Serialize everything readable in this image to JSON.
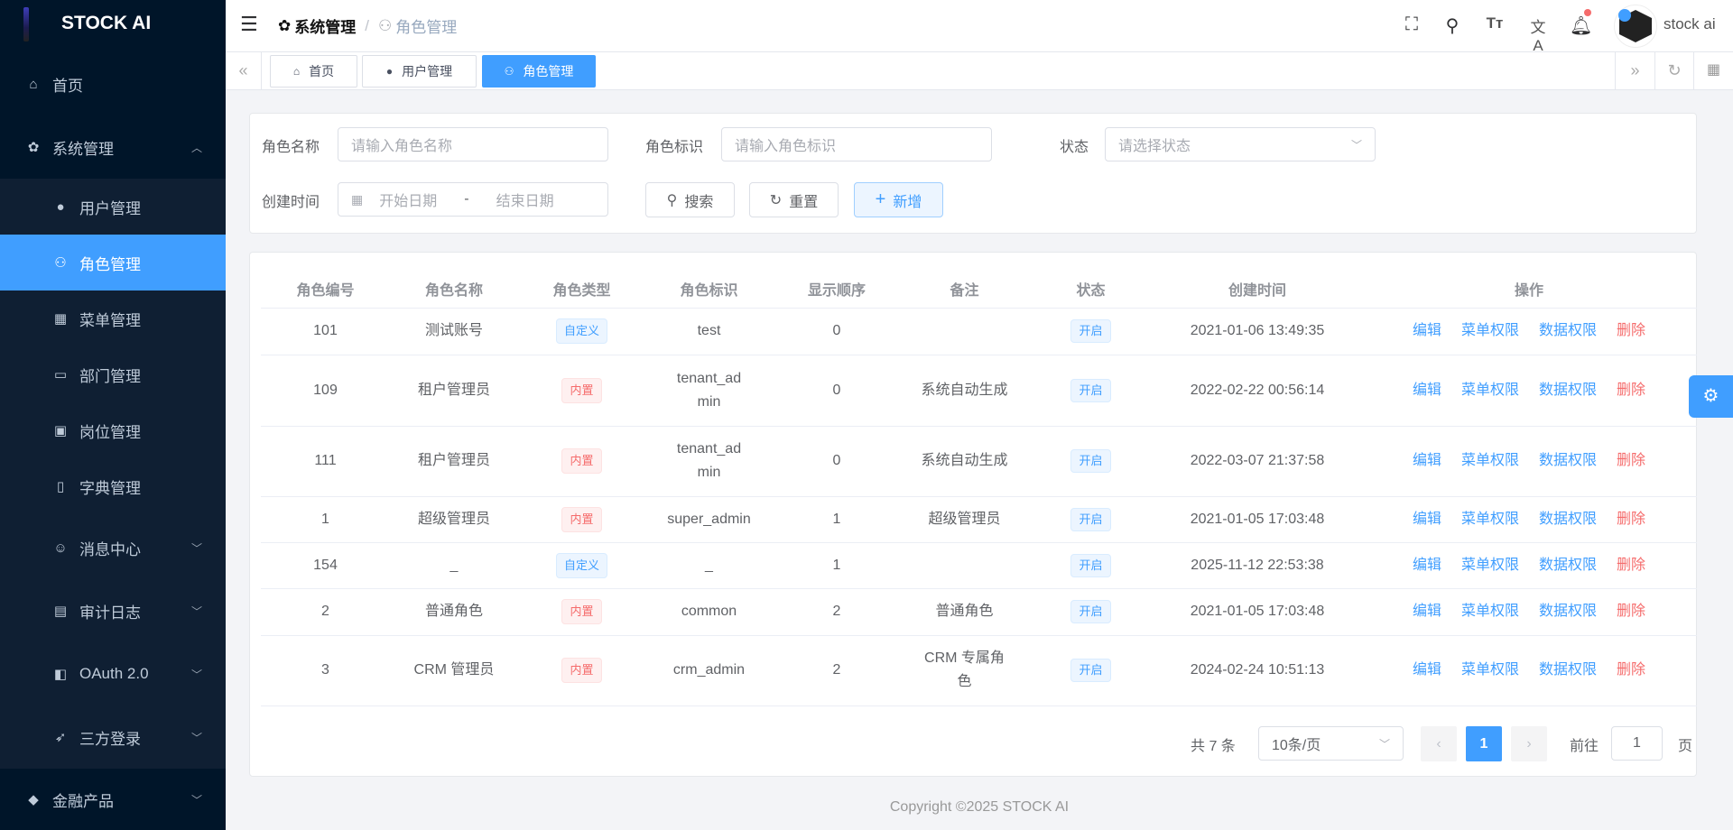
{
  "app": {
    "title": "STOCK AI",
    "user": "stock ai",
    "copyright": "Copyright ©2025 STOCK AI"
  },
  "sidebar": {
    "items": [
      {
        "label": "首页",
        "icon": "home-icon"
      },
      {
        "label": "系统管理",
        "icon": "gear-icon"
      },
      {
        "label": "用户管理",
        "icon": "user-icon"
      },
      {
        "label": "角色管理",
        "icon": "user-outline-icon"
      },
      {
        "label": "菜单管理",
        "icon": "grid-icon"
      },
      {
        "label": "部门管理",
        "icon": "id-card-icon"
      },
      {
        "label": "岗位管理",
        "icon": "badge-icon"
      },
      {
        "label": "字典管理",
        "icon": "book-icon"
      },
      {
        "label": "消息中心",
        "icon": "chat-icon"
      },
      {
        "label": "审计日志",
        "icon": "log-icon"
      },
      {
        "label": "OAuth 2.0",
        "icon": "oauth-icon"
      },
      {
        "label": "三方登录",
        "icon": "rocket-icon"
      },
      {
        "label": "金融产品",
        "icon": "diamond-icon"
      }
    ]
  },
  "breadcrumb": [
    "系统管理",
    "角色管理"
  ],
  "tabs": [
    {
      "label": "首页"
    },
    {
      "label": "用户管理"
    },
    {
      "label": "角色管理"
    }
  ],
  "filter": {
    "name_label": "角色名称",
    "name_placeholder": "请输入角色名称",
    "code_label": "角色标识",
    "code_placeholder": "请输入角色标识",
    "status_label": "状态",
    "status_placeholder": "请选择状态",
    "time_label": "创建时间",
    "start_placeholder": "开始日期",
    "end_placeholder": "结束日期",
    "sep": "-",
    "search": "搜索",
    "reset": "重置",
    "add": "新增"
  },
  "table": {
    "headers": [
      "角色编号",
      "角色名称",
      "角色类型",
      "角色标识",
      "显示顺序",
      "备注",
      "状态",
      "创建时间",
      "操作"
    ],
    "actions": [
      "编辑",
      "菜单权限",
      "数据权限",
      "删除"
    ],
    "rows": [
      {
        "id": "101",
        "name": "测试账号",
        "type": "自定义",
        "code": "test",
        "sort": "0",
        "remark": "",
        "status": "开启",
        "time": "2021-01-06 13:49:35"
      },
      {
        "id": "109",
        "name": "租户管理员",
        "type": "内置",
        "code": "tenant_admin",
        "sort": "0",
        "remark": "系统自动生成",
        "status": "开启",
        "time": "2022-02-22 00:56:14"
      },
      {
        "id": "111",
        "name": "租户管理员",
        "type": "内置",
        "code": "tenant_admin",
        "sort": "0",
        "remark": "系统自动生成",
        "status": "开启",
        "time": "2022-03-07 21:37:58"
      },
      {
        "id": "1",
        "name": "超级管理员",
        "type": "内置",
        "code": "super_admin",
        "sort": "1",
        "remark": "超级管理员",
        "status": "开启",
        "time": "2021-01-05 17:03:48"
      },
      {
        "id": "154",
        "name": "_",
        "type": "自定义",
        "code": "_",
        "sort": "1",
        "remark": "",
        "status": "开启",
        "time": "2025-11-12 22:53:38"
      },
      {
        "id": "2",
        "name": "普通角色",
        "type": "内置",
        "code": "common",
        "sort": "2",
        "remark": "普通角色",
        "status": "开启",
        "time": "2021-01-05 17:03:48"
      },
      {
        "id": "3",
        "name": "CRM 管理员",
        "type": "内置",
        "code": "crm_admin",
        "sort": "2",
        "remark": "CRM 专属角色",
        "status": "开启",
        "time": "2024-02-24 10:51:13"
      }
    ]
  },
  "pagination": {
    "total": "共 7 条",
    "page_size": "10条/页",
    "current": "1",
    "goto_label": "前往",
    "goto_value": "1",
    "page_suffix": "页"
  }
}
